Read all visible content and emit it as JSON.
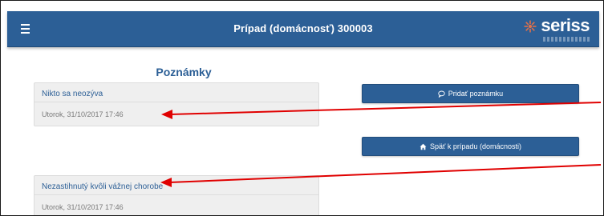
{
  "header": {
    "menu_icon": "hamburger-menu-icon",
    "title": "Prípad (domácnosť) 300003",
    "logo_text": "seriss",
    "logo_icon": "seriss-star-icon"
  },
  "notes": {
    "section_title": "Poznámky",
    "items": [
      {
        "text": "Nikto sa neozýva",
        "date": "Utorok, 31/10/2017 17:46"
      },
      {
        "text": "Nezastihnutý kvôli vážnej chorobe",
        "date": "Utorok, 31/10/2017 17:46"
      }
    ]
  },
  "actions": {
    "add_note_label": "Pridať poznámku",
    "add_note_icon": "comment-icon",
    "back_label": "Späť k prípadu (domácnosti)",
    "back_icon": "home-icon"
  },
  "colors": {
    "header_bg": "#2c5f96",
    "accent": "#2c5f96",
    "card_bg": "#efefef",
    "annotation": "#e00000",
    "logo_mark": "#e0704a"
  }
}
